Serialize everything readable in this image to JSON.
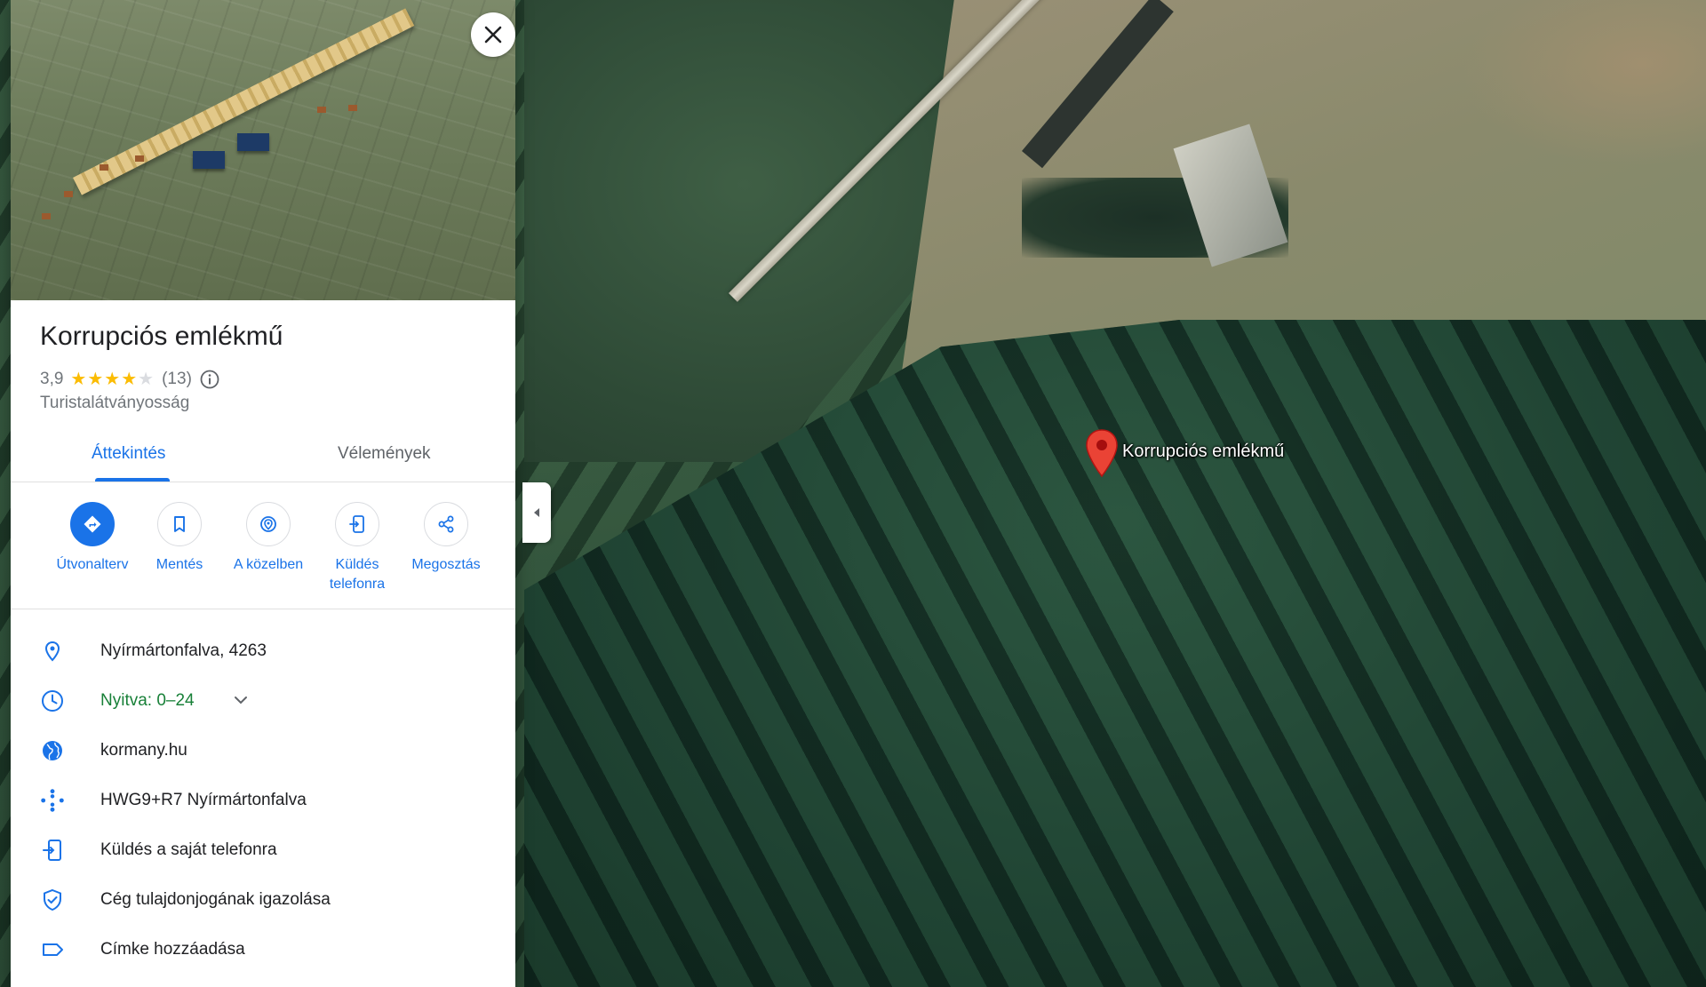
{
  "place": {
    "title": "Korrupciós emlékmű",
    "rating": "3,9",
    "rating_value": 3.9,
    "review_count": "(13)",
    "category": "Turistalátványosság"
  },
  "tabs": [
    {
      "label": "Áttekintés",
      "active": true
    },
    {
      "label": "Vélemények",
      "active": false
    }
  ],
  "actions": [
    {
      "label": "Útvonalterv",
      "icon": "directions-icon"
    },
    {
      "label": "Mentés",
      "icon": "bookmark-icon"
    },
    {
      "label": "A közelben",
      "icon": "nearby-icon"
    },
    {
      "label": "Küldés telefonra",
      "icon": "send-to-phone-icon"
    },
    {
      "label": "Megosztás",
      "icon": "share-icon"
    }
  ],
  "info": {
    "address": "Nyírmártonfalva, 4263",
    "hours": "Nyitva: 0–24",
    "website": "kormany.hu",
    "plus_code": "HWG9+R7 Nyírmártonfalva",
    "send_to_phone": "Küldés a saját telefonra",
    "claim_business": "Cég tulajdonjogának igazolása",
    "add_label": "Címke hozzáadása"
  },
  "map": {
    "marker_label": "Korrupciós emlékmű"
  },
  "colors": {
    "accent": "#1a73e8",
    "open_status": "#188038",
    "star": "#fbbc04",
    "marker": "#ea4335"
  }
}
